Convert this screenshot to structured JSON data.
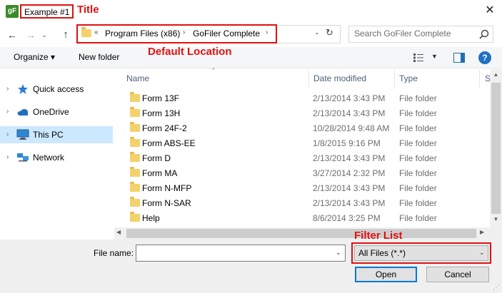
{
  "window": {
    "app_icon_text": "gF",
    "title": "Example #1",
    "close_glyph": "✕"
  },
  "annotations": {
    "title": "Title",
    "default_location": "Default Location",
    "filter_list": "Filter List"
  },
  "nav": {
    "back_glyph": "←",
    "forward_glyph": "→",
    "recent_glyph": "⌄",
    "up_glyph": "↑"
  },
  "address": {
    "overflow": "«",
    "crumbs": [
      "Program Files (x86)",
      "GoFiler Complete"
    ],
    "separator": "›",
    "dropdown_glyph": "⌄",
    "refresh_glyph": "↻"
  },
  "search": {
    "placeholder": "Search GoFiler Complete",
    "icon": "search-icon"
  },
  "toolbar": {
    "organize_label": "Organize ▾",
    "new_folder_label": "New folder",
    "view_drop_glyph": "▼",
    "help_label": "?"
  },
  "sidebar": {
    "items": [
      {
        "label": "Quick access",
        "icon": "star-icon",
        "selected": false
      },
      {
        "label": "OneDrive",
        "icon": "cloud-icon",
        "selected": false
      },
      {
        "label": "This PC",
        "icon": "monitor-icon",
        "selected": true
      },
      {
        "label": "Network",
        "icon": "network-icon",
        "selected": false
      }
    ],
    "chevron": "›"
  },
  "columns": {
    "name": "Name",
    "date": "Date modified",
    "type": "Type",
    "size": "S",
    "sort_glyph": "^"
  },
  "files": [
    {
      "name": "Form 13F",
      "date": "2/13/2014 3:43 PM",
      "type": "File folder"
    },
    {
      "name": "Form 13H",
      "date": "2/13/2014 3:43 PM",
      "type": "File folder"
    },
    {
      "name": "Form 24F-2",
      "date": "10/28/2014 9:48 AM",
      "type": "File folder"
    },
    {
      "name": "Form ABS-EE",
      "date": "1/8/2015 9:16 PM",
      "type": "File folder"
    },
    {
      "name": "Form D",
      "date": "2/13/2014 3:43 PM",
      "type": "File folder"
    },
    {
      "name": "Form MA",
      "date": "3/27/2014 2:32 PM",
      "type": "File folder"
    },
    {
      "name": "Form N-MFP",
      "date": "2/13/2014 3:43 PM",
      "type": "File folder"
    },
    {
      "name": "Form N-SAR",
      "date": "2/13/2014 3:43 PM",
      "type": "File folder"
    },
    {
      "name": "Help",
      "date": "8/6/2014 3:25 PM",
      "type": "File folder"
    }
  ],
  "scroll": {
    "up": "▲",
    "down": "▼",
    "left": "◀",
    "right": "▶"
  },
  "footer": {
    "filename_label": "File name:",
    "filename_value": "",
    "dropdown_glyph": "⌄",
    "filter_value": "All Files (*.*)",
    "open_label": "Open",
    "cancel_label": "Cancel",
    "grip": "⋰"
  },
  "colors": {
    "annotation": "#e01010",
    "selection": "#cce8ff",
    "accent": "#0078d7"
  }
}
